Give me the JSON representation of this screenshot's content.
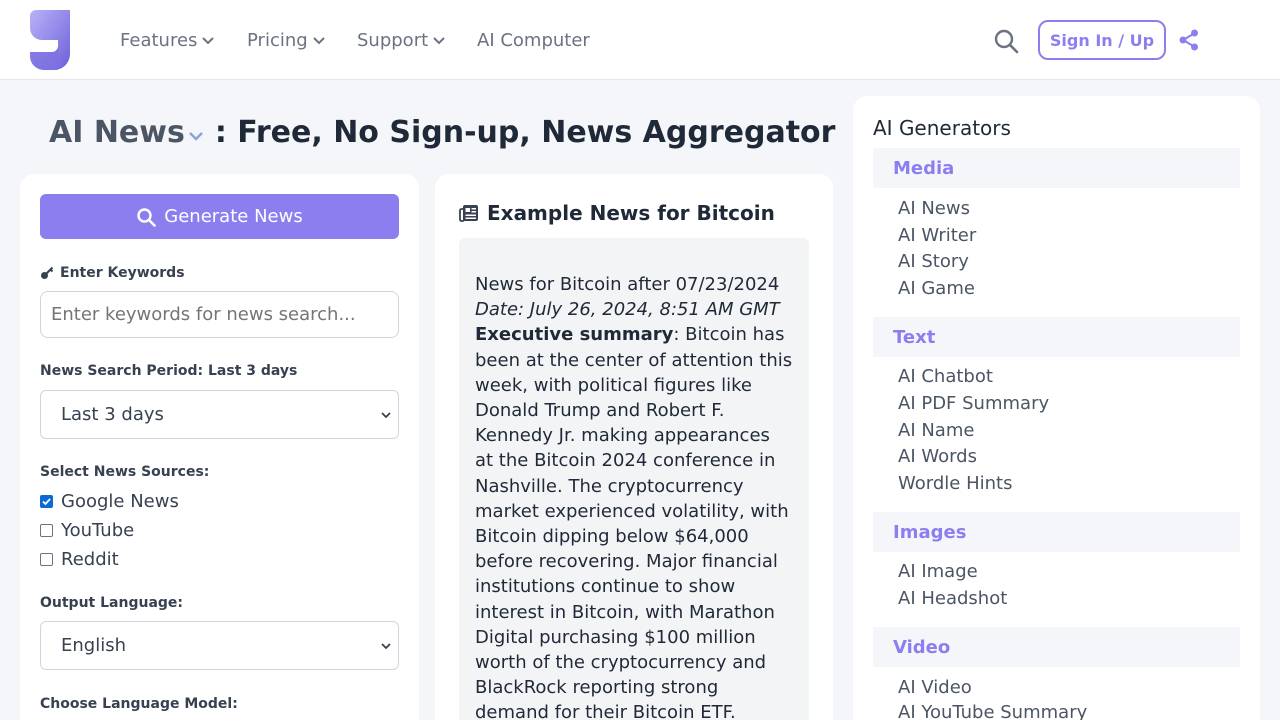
{
  "colors": {
    "accent": "#8b7ff0",
    "checkbox": "#0b6bd3",
    "page_bg": "#f4f6f9"
  },
  "header": {
    "nav": [
      {
        "label": "Features",
        "dropdown": true
      },
      {
        "label": "Pricing",
        "dropdown": true
      },
      {
        "label": "Support",
        "dropdown": true
      },
      {
        "label": "AI Computer",
        "dropdown": false
      }
    ],
    "signin_label": "Sign In / Up",
    "icons": [
      "logo-icon",
      "search-icon",
      "share-icon"
    ]
  },
  "title": {
    "main": "AI News",
    "rest": ": Free, No Sign-up, News Aggregator"
  },
  "form": {
    "generate_label": "Generate News",
    "keywords_label": "Enter Keywords",
    "keywords_placeholder": "Enter keywords for news search...",
    "period_label": "News Search Period: Last 3 days",
    "period_value": "Last 3 days",
    "sources_label": "Select News Sources:",
    "sources": [
      {
        "label": "Google News",
        "checked": true
      },
      {
        "label": "YouTube",
        "checked": false
      },
      {
        "label": "Reddit",
        "checked": false
      }
    ],
    "language_label": "Output Language:",
    "language_value": "English",
    "model_label": "Choose Language Model:"
  },
  "example": {
    "title": "Example News for Bitcoin",
    "line1": "News for Bitcoin after 07/23/2024",
    "date": "Date: July 26, 2024, 8:51 AM GMT",
    "summary_label": "Executive summary",
    "summary_text": ": Bitcoin has been at the center of attention this week, with political figures like Donald Trump and Robert F. Kennedy Jr. making appearances at the Bitcoin 2024 conference in Nashville. The cryptocurrency market experienced volatility, with Bitcoin dipping below $64,000 before recovering. Major financial institutions continue to show interest in Bitcoin, with Marathon Digital purchasing $100 million worth of the cryptocurrency and BlackRock reporting strong demand for their Bitcoin ETF."
  },
  "sidebar": {
    "title": "AI Generators",
    "groups": [
      {
        "name": "Media",
        "items": [
          "AI News",
          "AI Writer",
          "AI Story",
          "AI Game"
        ]
      },
      {
        "name": "Text",
        "items": [
          "AI Chatbot",
          "AI PDF Summary",
          "AI Name",
          "AI Words",
          "Wordle Hints"
        ]
      },
      {
        "name": "Images",
        "items": [
          "AI Image",
          "AI Headshot"
        ]
      },
      {
        "name": "Video",
        "items": [
          "AI Video",
          "AI YouTube Summary"
        ]
      }
    ]
  }
}
